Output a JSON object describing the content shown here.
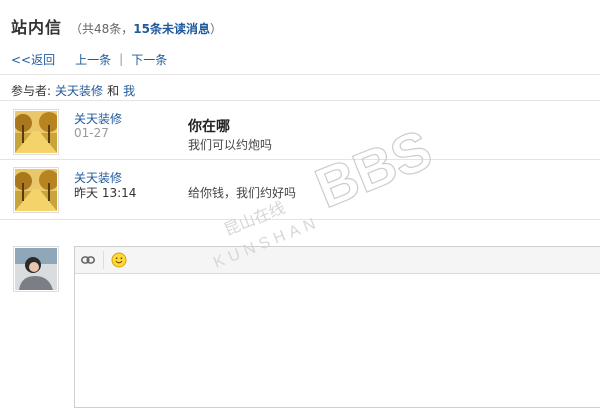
{
  "page": {
    "title": "站内信",
    "count_prefix": "（共48条，",
    "unread": "15条未读消息",
    "count_suffix": "）"
  },
  "nav": {
    "back": "<<返回",
    "prev": "上一条",
    "sep": "|",
    "next": "下一条"
  },
  "participants": {
    "label": "参与者:",
    "user": "关天装修",
    "and": "和",
    "me": "我"
  },
  "messages": [
    {
      "name": "关天装修",
      "time": "01-27",
      "subject": "你在哪",
      "body": "我们可以约炮吗"
    },
    {
      "name": "关天装修",
      "time": "昨天 13:14",
      "subject": "",
      "body": "给你钱，我们约好吗"
    }
  ],
  "editor": {
    "toolbar": [
      "link-icon",
      "smiley-icon"
    ],
    "value": ""
  },
  "watermark": {
    "cn": "昆山在线",
    "en": "KUNSHAN",
    "bbs": "BBS"
  },
  "colors": {
    "link": "#1f5a9c",
    "text": "#333333",
    "divider": "#e4e4e4"
  }
}
